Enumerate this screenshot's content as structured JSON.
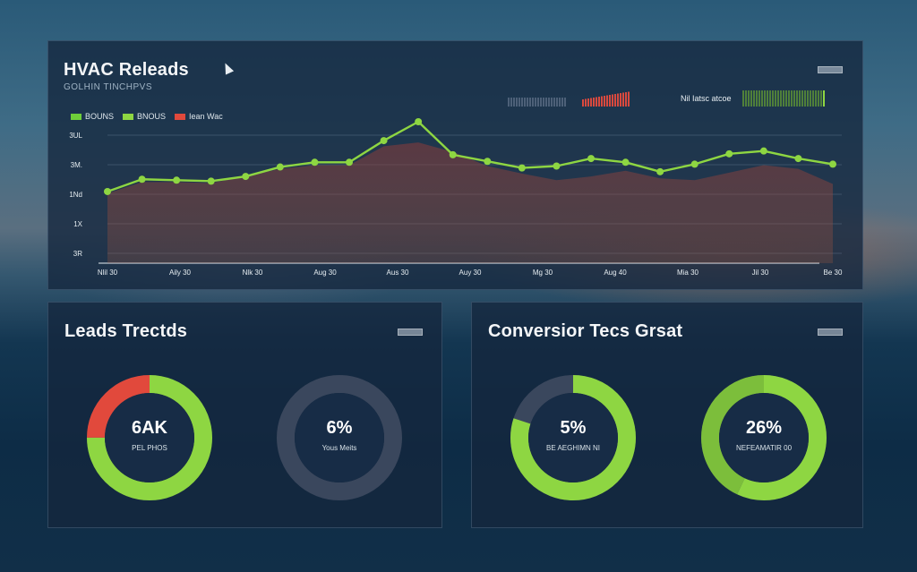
{
  "main_panel": {
    "title": "HVAC Releads",
    "subtitle": "GOLHIN TINCHPVS",
    "menu_icon": "menu-icon",
    "legend": [
      {
        "label": "BOUNS",
        "color": "#6fcf3a"
      },
      {
        "label": "BNOUS",
        "color": "#8ed642"
      },
      {
        "label": "Iean Wac",
        "color": "#e1493c"
      }
    ],
    "mini_label": "Nil Iatsc atcoe",
    "colors": {
      "accent": "#8ed642",
      "accent_dark": "#6fb23a",
      "danger": "#e1493c"
    }
  },
  "chart_data": {
    "type": "line",
    "x": [
      "Nlil 30",
      "Aily 30",
      "Nlk 30",
      "Aug 30",
      "Aus 30",
      "Auy 30",
      "Mg 30",
      "Aug 40",
      "Mia 30",
      "Jil 30",
      "Be 30"
    ],
    "ytick_labels": [
      "3R",
      "1X",
      "1Nd",
      "3M.",
      "3UL"
    ],
    "ylim": [
      0,
      150
    ],
    "series": [
      {
        "values": [
          76,
          89,
          88,
          87,
          92,
          102,
          107,
          107,
          130,
          150,
          115,
          108,
          101,
          103,
          111,
          107,
          97,
          105,
          116,
          119,
          111,
          105
        ],
        "color": "#8ed642"
      },
      {
        "values": [
          74,
          86,
          86,
          85,
          92,
          100,
          104,
          104,
          124,
          128,
          118,
          103,
          95,
          88,
          92,
          98,
          90,
          88,
          96,
          104,
          100,
          84
        ],
        "color": "#7a3a3a"
      }
    ],
    "grid": true
  },
  "leads_panel": {
    "title": "Leads Trectds",
    "menu_icon": "menu-icon",
    "donuts": [
      {
        "value_text": "6AK",
        "caption": "PEL PHOS",
        "segments": [
          {
            "pct": 75,
            "color": "#8ed642"
          },
          {
            "pct": 25,
            "color": "#e1493c"
          }
        ],
        "track": "#2f3e52"
      },
      {
        "value_text": "6%",
        "caption": "Yous Meits",
        "segments": [],
        "track": "#3a475d"
      }
    ]
  },
  "conversion_panel": {
    "title": "Conversior Tecs Grsat",
    "menu_icon": "menu-icon",
    "donuts": [
      {
        "value_text": "5%",
        "caption": "BE AEGHIMN NI",
        "segments": [
          {
            "pct": 80,
            "color": "#8ed642"
          }
        ],
        "track": "#3a475d"
      },
      {
        "value_text": "26%",
        "caption": "NEFEAMATIR 00",
        "segments": [
          {
            "pct": 57,
            "color": "#8ed642"
          },
          {
            "pct": 43,
            "color": "#7cbe3b"
          }
        ],
        "track": "#3a475d"
      }
    ]
  }
}
